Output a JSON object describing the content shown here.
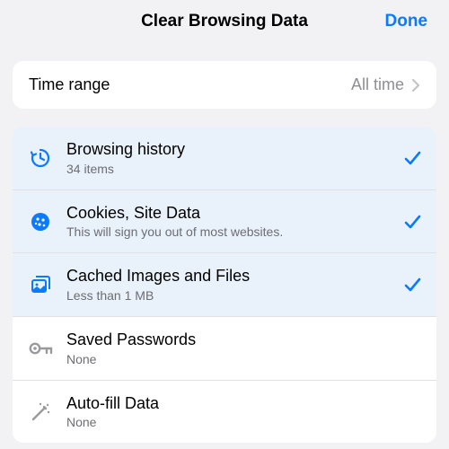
{
  "header": {
    "title": "Clear Browsing Data",
    "done_label": "Done"
  },
  "time_range": {
    "label": "Time range",
    "value": "All time"
  },
  "items": [
    {
      "title": "Browsing history",
      "sub": "34 items",
      "selected": true,
      "icon": "history"
    },
    {
      "title": "Cookies, Site Data",
      "sub": "This will sign you out of most websites.",
      "selected": true,
      "icon": "cookie"
    },
    {
      "title": "Cached Images and Files",
      "sub": "Less than 1 MB",
      "selected": true,
      "icon": "image-stack"
    },
    {
      "title": "Saved Passwords",
      "sub": "None",
      "selected": false,
      "icon": "key"
    },
    {
      "title": "Auto-fill Data",
      "sub": "None",
      "selected": false,
      "icon": "wand"
    }
  ],
  "colors": {
    "accent": "#0a7aff",
    "muted": "#9a9a9e"
  }
}
